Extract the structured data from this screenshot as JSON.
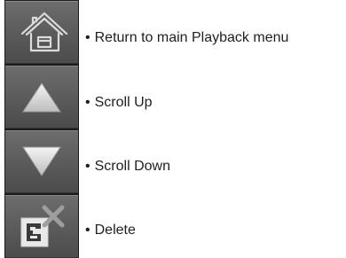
{
  "bullet": "•",
  "buttons": [
    {
      "icon": "home-icon",
      "label": "Return to main Playback menu"
    },
    {
      "icon": "arrow-up-icon",
      "label": "Scroll Up"
    },
    {
      "icon": "arrow-down-icon",
      "label": "Scroll Down"
    },
    {
      "icon": "delete-icon",
      "label": "Delete"
    }
  ],
  "colors": {
    "button_face": "#5e5e5e",
    "button_border": "#1c1c1c",
    "icon_light": "#e6e6e6",
    "text": "#1e1e1e"
  }
}
